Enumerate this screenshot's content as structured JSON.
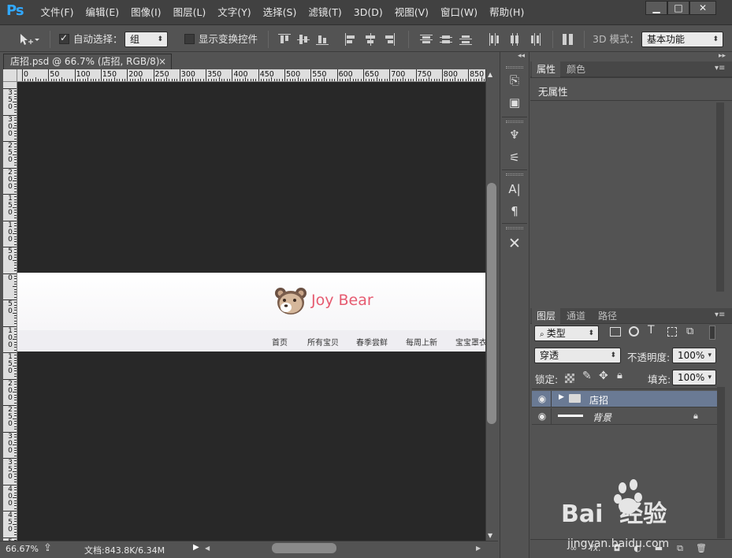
{
  "app": {
    "logo": "Ps",
    "menu": [
      "文件(F)",
      "编辑(E)",
      "图像(I)",
      "图层(L)",
      "文字(Y)",
      "选择(S)",
      "滤镜(T)",
      "3D(D)",
      "视图(V)",
      "窗口(W)",
      "帮助(H)"
    ],
    "window_buttons": [
      "▁",
      "□",
      "✕"
    ]
  },
  "options_bar": {
    "auto_select_label": "自动选择：",
    "auto_select_checked": true,
    "auto_select_value": "组",
    "transform_label": "显示变换控件",
    "transform_checked": false,
    "mode_label": "3D 模式：",
    "workspace_value": "基本功能"
  },
  "document": {
    "tab_label": "店招.psd @ 66.7% (店招, RGB/8)",
    "close_glyph": "×",
    "ruler_top_labels": [
      "0",
      "50",
      "100",
      "150",
      "200",
      "250",
      "300",
      "350",
      "400",
      "450",
      "500",
      "550",
      "600",
      "650",
      "700",
      "750",
      "800",
      "850"
    ],
    "ruler_left_labels": [
      "3 5 0",
      "3 0 0",
      "2 5 0",
      "2 0 0",
      "1 5 0",
      "1 0 0",
      "5 0",
      "0",
      "5 0",
      "1 0 0",
      "1 5 0",
      "2 0 0",
      "2 5 0",
      "3 0 0",
      "3 5 0",
      "4 0 0",
      "4 5 0",
      "5 0 0"
    ]
  },
  "banner": {
    "brand": "Joy Bear",
    "nav": [
      "首页",
      "所有宝贝",
      "春季尝鲜",
      "每周上新",
      "宝宝罩衣"
    ],
    "brand_color": "#e65a6f"
  },
  "status": {
    "zoom": "66.67%",
    "doc_size": "文档:843.8K/6.34M"
  },
  "props_panel": {
    "tabs": [
      "属性",
      "颜色"
    ],
    "body": "无属性"
  },
  "layers_panel": {
    "tabs": [
      "图层",
      "通道",
      "路径"
    ],
    "filter_value": "类型",
    "blend_mode": "穿透",
    "opacity_label": "不透明度:",
    "opacity_value": "100%",
    "lock_label": "锁定:",
    "fill_label": "填充:",
    "fill_value": "100%",
    "layers": [
      {
        "name": "店招",
        "type": "group",
        "selected": true
      },
      {
        "name": "背景",
        "type": "background",
        "locked": true
      }
    ],
    "bottom_buttons": [
      "link-icon",
      "fx-icon",
      "mask-icon",
      "adjustment-icon",
      "folder-icon",
      "new-layer-icon",
      "trash-icon"
    ]
  },
  "watermark": {
    "text": "Bai  经验",
    "sub": "jingyan.baidu.com"
  }
}
